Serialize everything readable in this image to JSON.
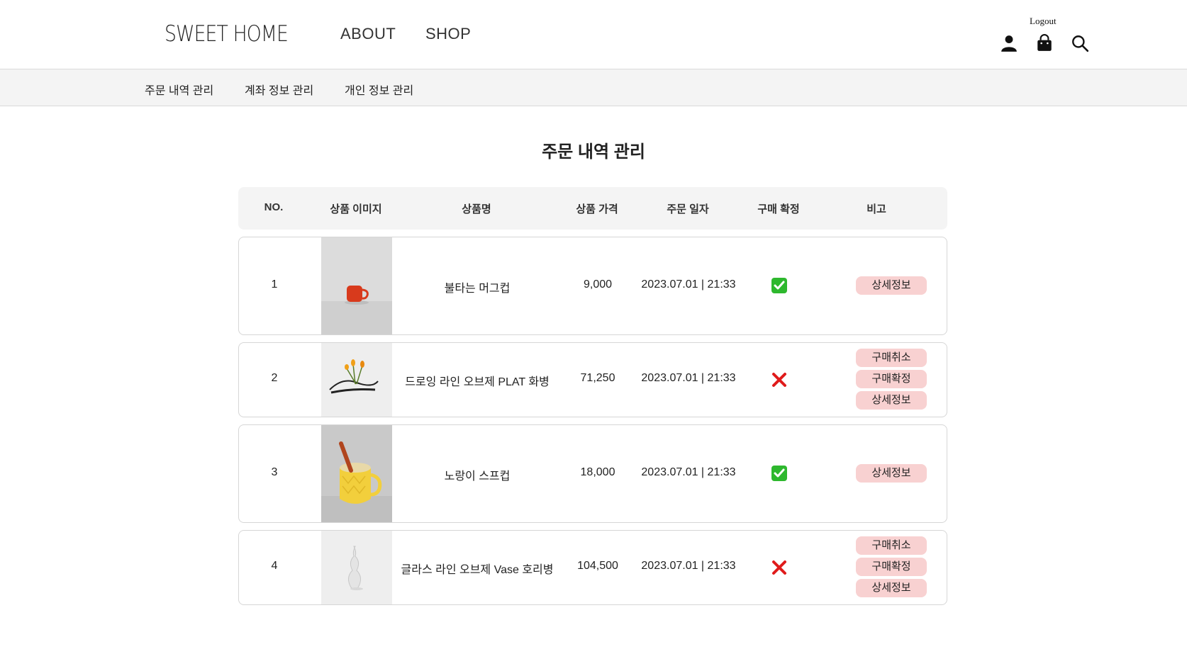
{
  "header": {
    "logo": "SWEET HOME",
    "nav": [
      "ABOUT",
      "SHOP"
    ],
    "logout": "Logout"
  },
  "subnav": [
    "주문 내역 관리",
    "계좌 정보 관리",
    "개인 정보 관리"
  ],
  "page_title": "주문 내역 관리",
  "table": {
    "headers": [
      "NO.",
      "상품 이미지",
      "상품명",
      "상품 가격",
      "주문 일자",
      "구매 확정",
      "비고"
    ],
    "rows": [
      {
        "no": "1",
        "name": "불타는 머그컵",
        "price": "9,000",
        "date": "2023.07.01 | 21:33",
        "confirmed": true,
        "actions": [
          "상세정보"
        ]
      },
      {
        "no": "2",
        "name": "드로잉 라인 오브제 PLAT 화병",
        "price": "71,250",
        "date": "2023.07.01 | 21:33",
        "confirmed": false,
        "actions": [
          "구매취소",
          "구매확정",
          "상세정보"
        ]
      },
      {
        "no": "3",
        "name": "노랑이 스프컵",
        "price": "18,000",
        "date": "2023.07.01 | 21:33",
        "confirmed": true,
        "actions": [
          "상세정보"
        ]
      },
      {
        "no": "4",
        "name": "글라스 라인 오브제 Vase 호리병",
        "price": "104,500",
        "date": "2023.07.01 | 21:33",
        "confirmed": false,
        "actions": [
          "구매취소",
          "구매확정",
          "상세정보"
        ]
      }
    ]
  },
  "icons": {
    "user": "user-icon",
    "bag": "shopping-bag-icon",
    "search": "search-icon",
    "confirmed": "check-mark-icon",
    "not_confirmed": "cross-mark-icon"
  },
  "colors": {
    "pill_bg": "#f8d1d1",
    "check_green": "#2eb82e",
    "cross_red": "#e01b1b",
    "header_gray": "#f4f4f4"
  }
}
